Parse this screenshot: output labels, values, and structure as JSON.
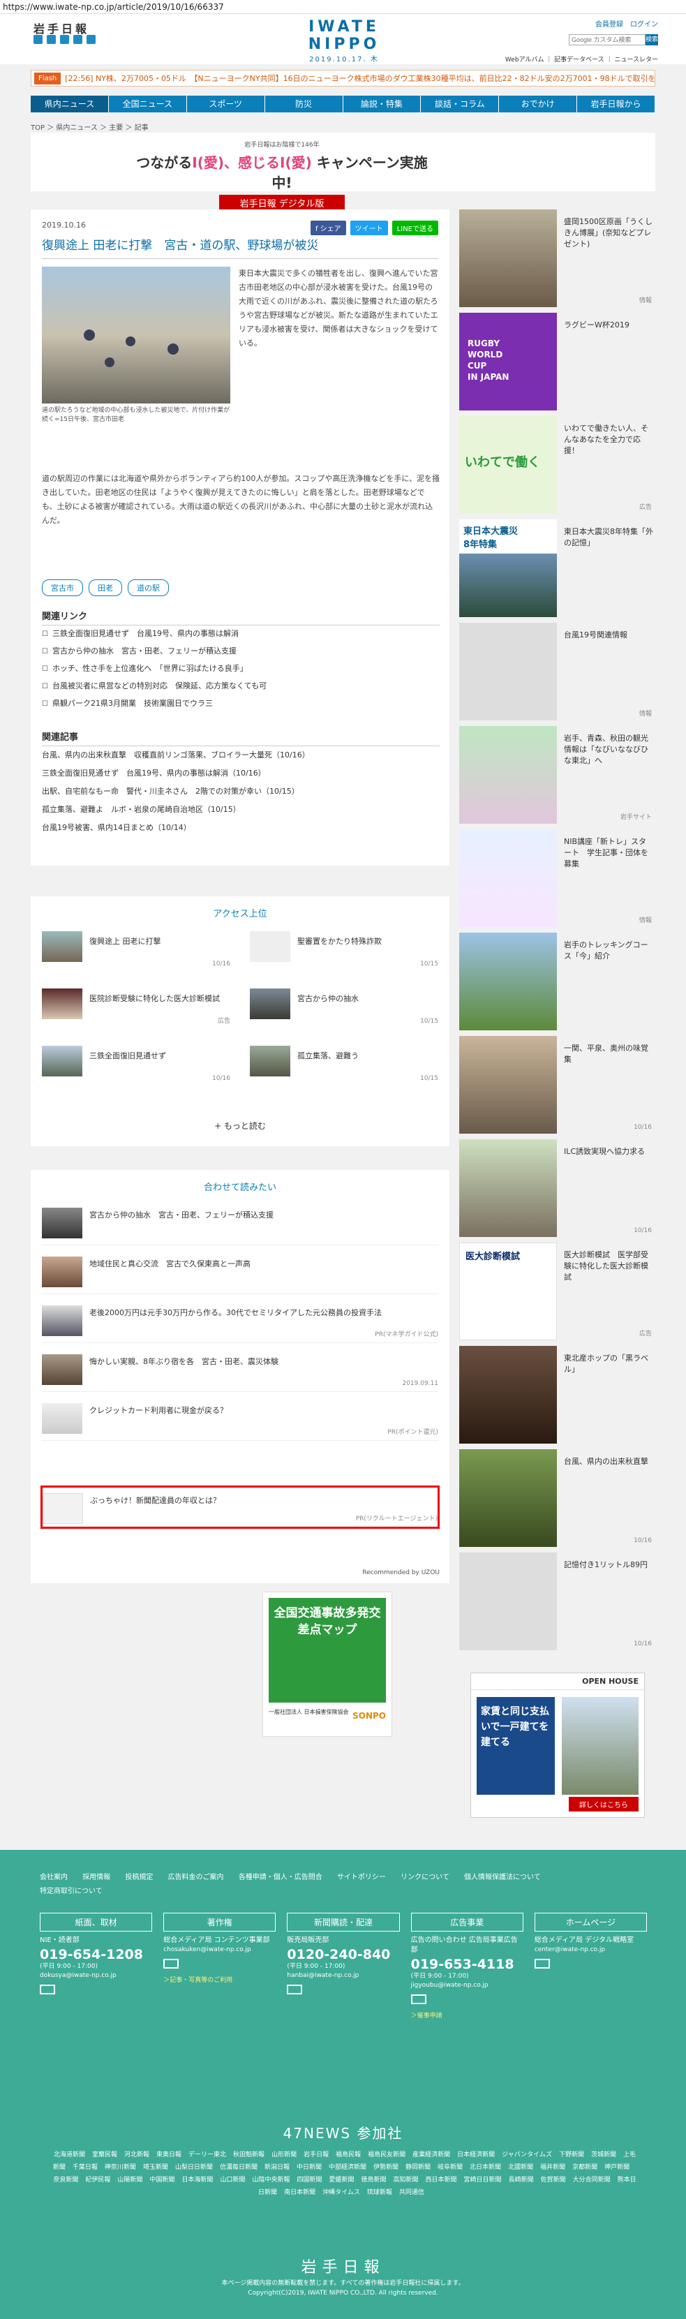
{
  "url": "https://www.iwate-np.co.jp/article/2019/10/16/66337",
  "header": {
    "logo_left": "岩手日報",
    "center_title": "IWATE NIPPO",
    "center_date": "2019.10.17. 木",
    "links_top": "会員登録　ログイン",
    "search_placeholder": "Google カスタム検索",
    "search_button": "検索",
    "links_sub": "Webアルバム ｜ 記事データベース ｜ ニュースレター"
  },
  "flash": {
    "label": "Flash",
    "text": "[22:56] NY株、2万7005・05ドル　【NニューヨークNY共同】16日のニューヨーク株式市場のダウ工業株30種平均は、前日比22・82ドル安の2万7001・98ドルで取引を終えた。"
  },
  "nav": [
    "県内ニュース",
    "全国ニュース",
    "スポーツ",
    "防災",
    "論説・特集",
    "談話・コラム",
    "おでかけ",
    "岩手日報から"
  ],
  "breadcrumb": "TOP ＞ 県内ニュース ＞ 主要 ＞ 記事",
  "banner": {
    "small": "岩手日報はお陰様で146年",
    "main_a": "つながる",
    "main_b": "I(愛)、感じる",
    "main_c": "I(愛)",
    "main_d": " キャンペーン実施中!",
    "brand": "岩手日報 デジタル版"
  },
  "article": {
    "date": "2019.10.16",
    "share": [
      "f シェア",
      "ツイート",
      "LINEで送る"
    ],
    "title": "復興途上 田老に打撃　宮古・道の駅、野球場が被災",
    "caption": "道の駅たろうなど地域の中心部も浸水した被災地で、片付け作業が続く=15日午後、宮古市田老",
    "body1": "東日本大震災で多くの犠牲者を出し、復興へ進んでいた宮古市田老地区の中心部が浸水被害を受けた。台風19号の大雨で近くの川があふれ、震災後に整備された道の駅たろうや宮古野球場などが被災。新たな道路が生まれていたエリアも浸水被害を受け、関係者は大きなショックを受けている。",
    "body2": "道の駅周辺の作業には北海道や県外からボランティアら約100人が参加。スコップや高圧洗浄機などを手に、泥を掻き出していた。田老地区の住民は「ようやく復興が見えてきたのに悔しい」と肩を落とした。田老野球場などでも、土砂による被害が確認されている。大雨は道の駅近くの長沢川があふれ、中心部に大量の土砂と泥水が流れ込んだ。",
    "tags": [
      "宮古市",
      "田老",
      "道の駅"
    ],
    "related_links_title": "関連リンク",
    "related_links": [
      "三鉄全面復旧見通せず　台風19号、県内の事態は解消",
      "宮古から仲の抽水　宮古・田老、フェリーが積込支援",
      "ホッチ、性さ手を上位進化へ　「世界に羽ばたける良手」",
      "台風被災者に県営などの特別対応　保険延、応方策なくても可",
      "県観パーク21県3月開業　技術業園日でウラ三"
    ],
    "related_articles_title": "関連記事",
    "related_articles": [
      "台風、県内の出来秋直撃　収穫直前リンゴ落果、ブロイラー大量死（10/16）",
      "三鉄全面復旧見通せず　台風19号、県内の事態は解消（10/16）",
      "出駅、自宅前なもー命　警代・川圭ネさん　2階での対策が幸い（10/15）",
      "孤立集落、避難よ　ルボ・岩泉の尾崎自治地区（10/15）",
      "台風19号被害、県内14日まとめ（10/14）"
    ]
  },
  "access": {
    "title": "アクセス上位",
    "items": [
      {
        "title": "復興途上 田老に打撃",
        "time": "10/16"
      },
      {
        "title": "聖審置をかたり特殊詐欺",
        "time": "10/15"
      },
      {
        "title": "医院診断受験に特化した医大診断模試",
        "time": "広告"
      },
      {
        "title": "宮古から仲の抽水",
        "time": "10/15"
      },
      {
        "title": "三鉄全面復旧見通せず",
        "time": "10/16"
      },
      {
        "title": "孤立集落、避難う",
        "time": "10/15"
      }
    ],
    "more": "+ もっと読む"
  },
  "read": {
    "title": "合わせて読みたい",
    "items": [
      {
        "title": "宮古から仲の抽水　宮古・田老、フェリーが積込支援",
        "meta": ""
      },
      {
        "title": "地域住民と真心交流　宮古で久保東高と一声高",
        "meta": ""
      },
      {
        "title": "老後2000万円は元手30万円から作る。30代でセミリタイアした元公務員の投資手法",
        "meta": "PR(マネ学ガイド公式)"
      },
      {
        "title": "悔かしい実親、8年ぶり宿を各　宮古・田老、震災体験",
        "meta": "2019.09.11"
      },
      {
        "title": "クレジットカード利用者に現金が戻る？",
        "meta": "PR(ポイント還元)"
      },
      {
        "title": "ぶっちゃけ！新聞配達員の年収とは？",
        "meta": "PR(リクルートエージェント)"
      }
    ],
    "powered": "Recommended by UZOU"
  },
  "ad": {
    "title": "全国交通事故多発交差点マップ",
    "org": "一般社団法人 日本損害保険協会",
    "sponsor": "SONPO"
  },
  "side": [
    {
      "title": "盛岡1500区原画「うくしきん博展」(奈知などプレゼント)",
      "time": "情報"
    },
    {
      "title": "ラグビーW杯2019",
      "time": ""
    },
    {
      "title": "いわてで働きたい人、そんなあなたを全力で応援！",
      "time": "広告"
    },
    {
      "title": "東日本大震災8年特集「外の記憶」",
      "time": ""
    },
    {
      "title": "台風19号関連情報",
      "time": "情報"
    },
    {
      "title": "岩手、青森、秋田の観光情報は「なびいななびひな東北」へ",
      "time": "岩手サイト"
    },
    {
      "title": "NIB講座「新トレ」スタート　学生記事・団体を募集",
      "time": "情報"
    },
    {
      "title": "岩手のトレッキングコース「今」紹介",
      "time": ""
    },
    {
      "title": "一関、平泉、奥州の味覚集",
      "time": "10/16"
    },
    {
      "title": "ILC誘致実現へ協力求る",
      "time": "10/16"
    },
    {
      "title": "医大診断模試　医学部受験に特化した医大診断模試",
      "time": "広告"
    },
    {
      "title": "東北産ホップの「黒ラベル」",
      "time": ""
    },
    {
      "title": "台風、県内の出来秋直撃",
      "time": "10/16"
    },
    {
      "title": "記憶付き1リットル89円",
      "time": "10/16"
    }
  ],
  "side_ad": {
    "line1": "家賃と同じ支払いで一戸建てを建てる",
    "badge": "OPEN HOUSE",
    "footer": "詳しくはこちら"
  },
  "footer": {
    "links": [
      "会社案内",
      "採用情報",
      "投稿規定",
      "広告料金のご案内",
      "各種申請・個人・広告問合",
      "サイトポリシー",
      "リンクについて",
      "個人情報保護法について",
      "特定商取引について"
    ],
    "cols": [
      {
        "head": "紙面、取材",
        "sub": "NIE・読者部",
        "tel": "019-654-1208",
        "hours": "(平日 9:00 - 17:00)",
        "mail": "dokusya@iwate-np.co.jp",
        "extra": ""
      },
      {
        "head": "著作権",
        "sub": "総合メディア局 コンテンツ事業部",
        "tel": "",
        "hours": "",
        "mail": "chosakuken@iwate-np.co.jp",
        "extra": "＞記事・写真等のご利用"
      },
      {
        "head": "新聞購読・配達",
        "sub": "販売局販売部",
        "tel": "0120-240-840",
        "hours": "(平日 9:00 - 17:00)",
        "mail": "hanbai@iwate-np.co.jp",
        "extra": ""
      },
      {
        "head": "広告事業",
        "sub": "広告の問い合わせ 広告局事業広告部",
        "tel": "019-653-4118",
        "hours": "(平日 9:00 - 17:00)",
        "mail": "jigyoubu@iwate-np.co.jp",
        "extra": "＞催事申請"
      },
      {
        "head": "ホームページ",
        "sub": "総合メディア局 デジタル戦略室",
        "tel": "",
        "hours": "",
        "mail": "center@iwate-np.co.jp",
        "extra": ""
      }
    ],
    "n47": "47NEWS 参加社",
    "papers": [
      "北海道新聞",
      "室蘭民報",
      "河北新報",
      "東奥日報",
      "デーリー東北",
      "秋田魁新報",
      "山形新聞",
      "岩手日報",
      "福島民報",
      "福島民友新聞",
      "産業経済新聞",
      "日本経済新聞",
      "ジャパンタイムズ",
      "下野新聞",
      "茨城新聞",
      "上毛新聞",
      "千葉日報",
      "神奈川新聞",
      "埼玉新聞",
      "山梨日日新聞",
      "信濃毎日新聞",
      "新潟日報",
      "中日新聞",
      "中部経済新聞",
      "伊勢新聞",
      "静岡新聞",
      "岐阜新聞",
      "北日本新聞",
      "北國新聞",
      "福井新聞",
      "京都新聞",
      "神戸新聞",
      "奈良新聞",
      "紀伊民報",
      "山陽新聞",
      "中国新聞",
      "日本海新聞",
      "山口新聞",
      "山陰中央新報",
      "四国新聞",
      "愛媛新聞",
      "徳島新聞",
      "高知新聞",
      "西日本新聞",
      "宮崎日日新聞",
      "長崎新聞",
      "佐賀新聞",
      "大分合同新聞",
      "熊本日日新聞",
      "南日本新聞",
      "沖縄タイムス",
      "琉球新報",
      "共同通信"
    ],
    "logo": "岩手日報",
    "note1": "本ページ掲載内容の無断転載を禁じます。すべての著作権は岩手日報社に帰属します。",
    "note2": "Copyright(C)2019, IWATE NIPPO CO.,LTD. All rights reserved."
  }
}
